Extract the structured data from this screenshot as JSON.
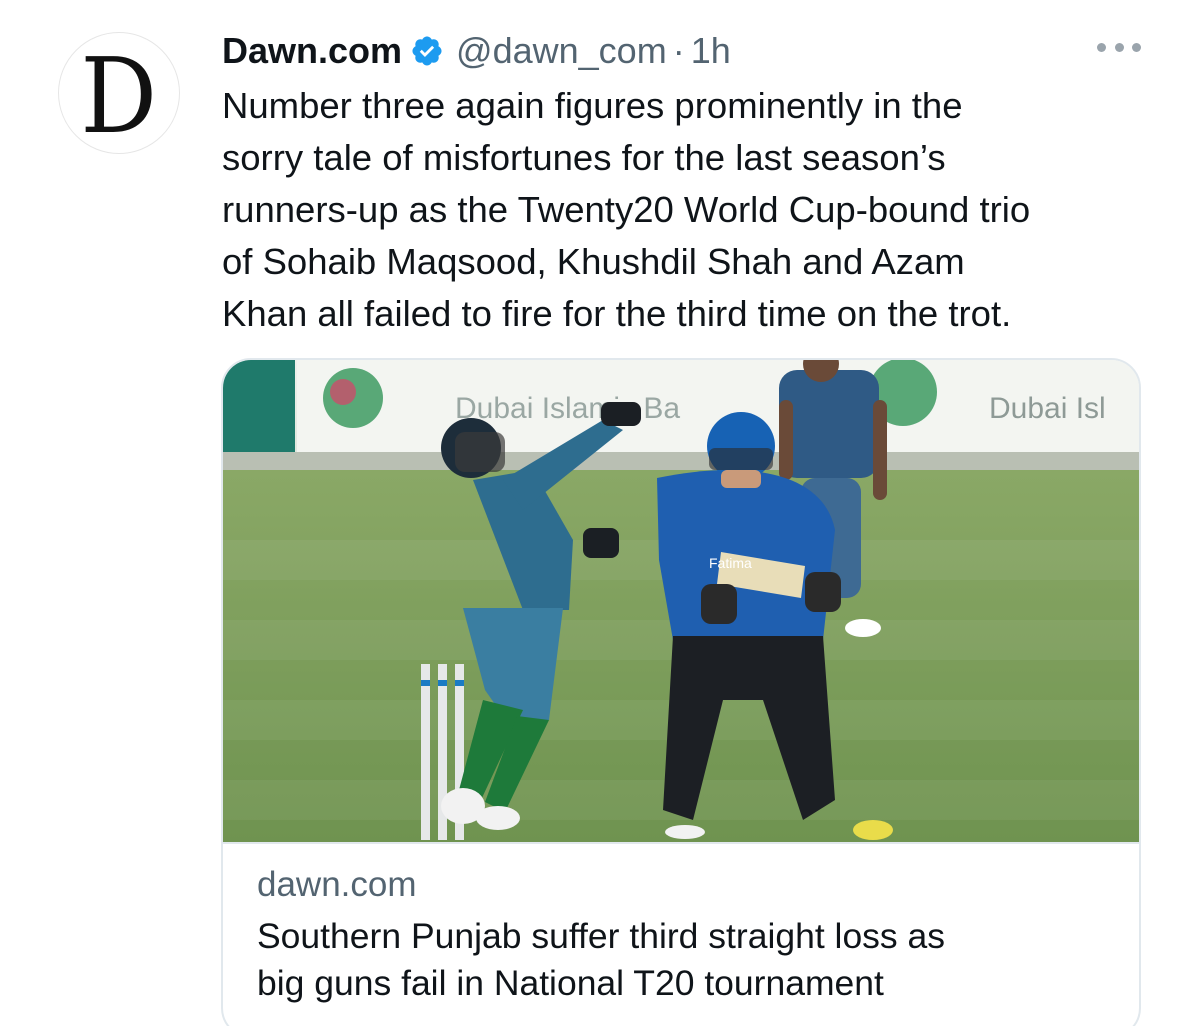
{
  "tweet": {
    "avatar_letter": "D",
    "display_name": "Dawn.com",
    "handle": "@dawn_com",
    "separator": "·",
    "time": "1h",
    "text_lines": [
      "Number three again figures prominently in the",
      "sorry tale of misfortunes for the last season’s",
      "runners-up as the Twenty20 World Cup-bound trio",
      "of Sohaib Maqsood, Khushdil Shah and Azam",
      "Khan all failed to fire for the third time on the trot."
    ]
  },
  "card": {
    "domain": "dawn.com",
    "title_lines": [
      "Southern Punjab suffer third straight loss as",
      "big guns fail in National T20 tournament"
    ],
    "image": {
      "board_text_left": "Dubai Islamic Ba",
      "board_text_right": "Dubai Isl",
      "sponsor_on_shirt": "Fatima"
    }
  },
  "colors": {
    "verified_badge": "#1d9bf0",
    "secondary_text": "#536471",
    "primary_text": "#0f1419",
    "card_border": "#e1e8ed",
    "grass": "#7fa058"
  },
  "icons": {
    "verified": "verified-badge-icon",
    "more": "more-options-icon"
  }
}
